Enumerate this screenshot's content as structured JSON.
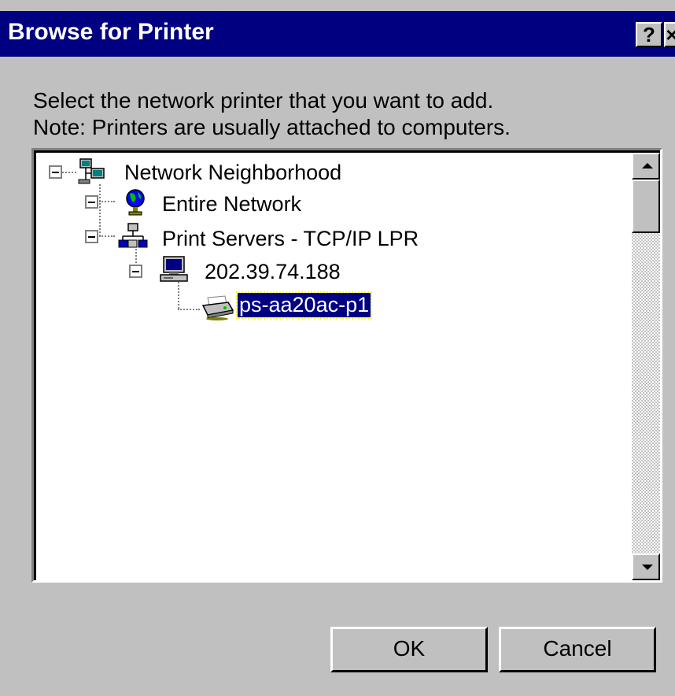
{
  "window": {
    "title": "Browse for Printer",
    "help_label": "?",
    "close_label": "×"
  },
  "instructions": {
    "line1": "Select the network printer that you want to add.",
    "line2": "Note: Printers are usually attached to computers."
  },
  "tree": {
    "root": {
      "label": "Network Neighborhood",
      "icon": "network-neighborhood-icon"
    },
    "entire_network": {
      "label": "Entire Network",
      "icon": "globe-icon"
    },
    "print_servers": {
      "label": "Print Servers - TCP/IP LPR",
      "icon": "network-servers-icon"
    },
    "computer": {
      "label": "202.39.74.188",
      "icon": "computer-icon"
    },
    "printer": {
      "label": "ps-aa20ac-p1",
      "icon": "printer-icon",
      "selected": true
    }
  },
  "buttons": {
    "ok": "OK",
    "cancel": "Cancel"
  },
  "colors": {
    "titlebar": "#000080",
    "selection": "#000080",
    "face": "#c0c0c0"
  }
}
